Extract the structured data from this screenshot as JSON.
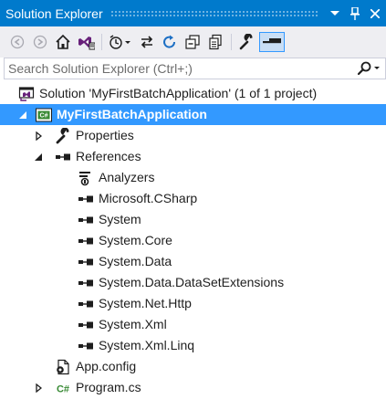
{
  "window": {
    "title": "Solution Explorer"
  },
  "colors": {
    "accent": "#007acc",
    "selection": "#3399ff",
    "toolbar_bg": "#eeeef2",
    "csharp_green": "#388a34",
    "vs_purple": "#68217a"
  },
  "toolbar": {
    "buttons": [
      "back-icon",
      "forward-icon",
      "home-icon",
      "vs-switch-views-icon",
      "pending-changes-filter-icon",
      "sync-with-active-document-icon",
      "refresh-icon",
      "collapse-all-icon",
      "show-all-files-icon",
      "properties-icon",
      "preview-selected-items-icon"
    ]
  },
  "search": {
    "placeholder": "Search Solution Explorer (Ctrl+;)"
  },
  "tree": {
    "solution": {
      "label": "Solution 'MyFirstBatchApplication' (1 of 1 project)",
      "icon": "solution-icon"
    },
    "project": {
      "label": "MyFirstBatchApplication",
      "icon": "csharp-project-icon",
      "expanded": true,
      "selected": true
    },
    "properties": {
      "label": "Properties",
      "icon": "wrench-icon",
      "expanded": false
    },
    "references": {
      "label": "References",
      "icon": "references-icon",
      "expanded": true
    },
    "reference_items": [
      {
        "label": "Analyzers",
        "icon": "analyzers-icon"
      },
      {
        "label": "Microsoft.CSharp",
        "icon": "reference-icon"
      },
      {
        "label": "System",
        "icon": "reference-icon"
      },
      {
        "label": "System.Core",
        "icon": "reference-icon"
      },
      {
        "label": "System.Data",
        "icon": "reference-icon"
      },
      {
        "label": "System.Data.DataSetExtensions",
        "icon": "reference-icon"
      },
      {
        "label": "System.Net.Http",
        "icon": "reference-icon"
      },
      {
        "label": "System.Xml",
        "icon": "reference-icon"
      },
      {
        "label": "System.Xml.Linq",
        "icon": "reference-icon"
      }
    ],
    "app_config": {
      "label": "App.config",
      "icon": "config-file-icon"
    },
    "program": {
      "label": "Program.cs",
      "icon": "csharp-file-icon",
      "expanded": false
    }
  }
}
